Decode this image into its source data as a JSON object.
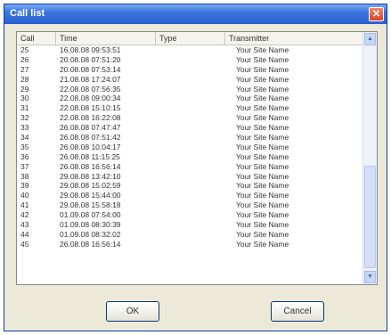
{
  "window": {
    "title": "Call list",
    "close_glyph": "✕"
  },
  "list": {
    "columns": {
      "call": "Call",
      "time": "Time",
      "type": "Type",
      "transmitter": "Transmitter"
    },
    "rows": [
      {
        "call": "25",
        "time": "16.08.08 09:53:51",
        "type": "",
        "transmitter": "Your Site Name"
      },
      {
        "call": "26",
        "time": "20.08.08 07:51:20",
        "type": "",
        "transmitter": "Your Site Name"
      },
      {
        "call": "27",
        "time": "20.08.08 07:53:14",
        "type": "",
        "transmitter": "Your Site Name"
      },
      {
        "call": "28",
        "time": "21.08.08 17:24:07",
        "type": "",
        "transmitter": "Your Site Name"
      },
      {
        "call": "29",
        "time": "22.08.08 07:56:35",
        "type": "",
        "transmitter": "Your Site Name"
      },
      {
        "call": "30",
        "time": "22.08.08 09:00:34",
        "type": "",
        "transmitter": "Your Site Name"
      },
      {
        "call": "31",
        "time": "22.08.08 15:10:15",
        "type": "",
        "transmitter": "Your Site Name"
      },
      {
        "call": "32",
        "time": "22.08.08 16:22:08",
        "type": "",
        "transmitter": "Your Site Name"
      },
      {
        "call": "33",
        "time": "26.08.08 07:47:47",
        "type": "",
        "transmitter": "Your Site Name"
      },
      {
        "call": "34",
        "time": "26.08.08 07:51:42",
        "type": "",
        "transmitter": "Your Site Name"
      },
      {
        "call": "35",
        "time": "26.08.08 10:04:17",
        "type": "",
        "transmitter": "Your Site Name"
      },
      {
        "call": "36",
        "time": "26.08.08 11:15:25",
        "type": "",
        "transmitter": "Your Site Name"
      },
      {
        "call": "37",
        "time": "26.08.08 16:56:14",
        "type": "",
        "transmitter": "Your Site Name"
      },
      {
        "call": "38",
        "time": "29.08.08 13:42:10",
        "type": "",
        "transmitter": "Your Site Name"
      },
      {
        "call": "39",
        "time": "29.08.08 15:02:59",
        "type": "",
        "transmitter": "Your Site Name"
      },
      {
        "call": "40",
        "time": "29.08.08 15:44:00",
        "type": "",
        "transmitter": "Your Site Name"
      },
      {
        "call": "41",
        "time": "29.08.08 15:58:18",
        "type": "",
        "transmitter": "Your Site Name"
      },
      {
        "call": "42",
        "time": "01.09.08 07:54:00",
        "type": "",
        "transmitter": "Your Site Name"
      },
      {
        "call": "43",
        "time": "01.09.08 08:30:39",
        "type": "",
        "transmitter": "Your Site Name"
      },
      {
        "call": "44",
        "time": "01.09.08 08:32:02",
        "type": "",
        "transmitter": "Your Site Name"
      },
      {
        "call": "45",
        "time": "26.08.08 16:56:14",
        "type": "",
        "transmitter": "Your Site Name"
      }
    ]
  },
  "buttons": {
    "ok": "OK",
    "cancel": "Cancel"
  },
  "scrollbar": {
    "up_glyph": "▲",
    "down_glyph": "▼"
  },
  "colors": {
    "titlebar": "#2a60d0",
    "close": "#d6452a",
    "dialog_bg": "#ece9d8"
  }
}
